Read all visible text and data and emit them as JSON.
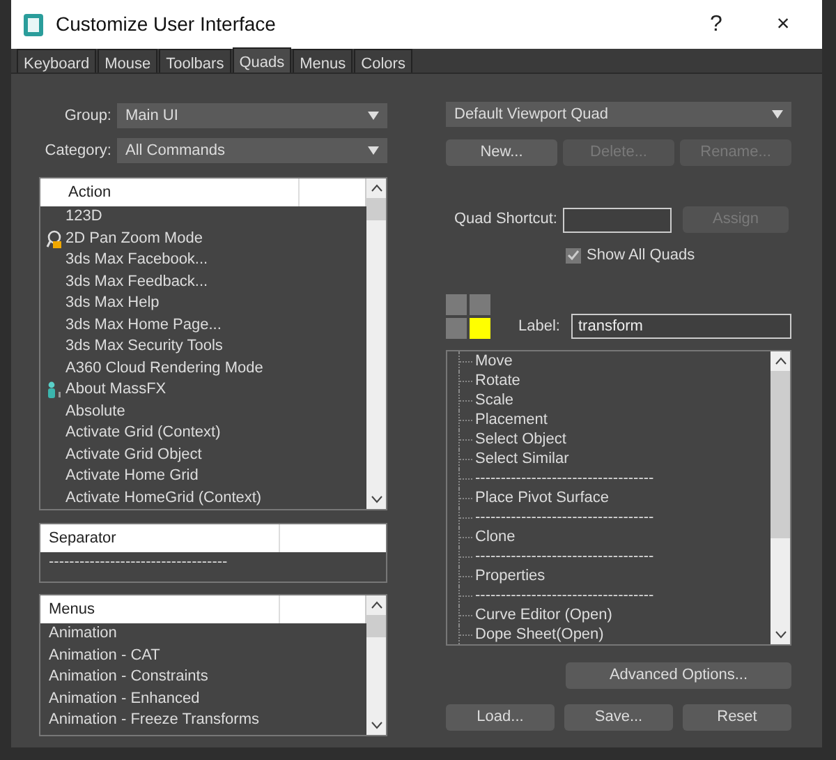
{
  "window": {
    "title": "Customize User Interface",
    "help": "?",
    "close": "×"
  },
  "tabs": [
    {
      "label": "Keyboard",
      "selected": false
    },
    {
      "label": "Mouse",
      "selected": false
    },
    {
      "label": "Toolbars",
      "selected": false
    },
    {
      "label": "Quads",
      "selected": true
    },
    {
      "label": "Menus",
      "selected": false
    },
    {
      "label": "Colors",
      "selected": false
    }
  ],
  "group": {
    "label": "Group:",
    "value": "Main UI"
  },
  "category": {
    "label": "Category:",
    "value": "All Commands"
  },
  "action_list": {
    "header": "Action",
    "items": [
      {
        "text": "123D"
      },
      {
        "text": "2D Pan Zoom Mode",
        "kind": "magnifier"
      },
      {
        "text": "3ds Max Facebook..."
      },
      {
        "text": "3ds Max Feedback..."
      },
      {
        "text": "3ds Max Help"
      },
      {
        "text": "3ds Max Home Page..."
      },
      {
        "text": "3ds Max Security Tools"
      },
      {
        "text": "A360 Cloud Rendering Mode"
      },
      {
        "text": "About MassFX",
        "kind": "figure"
      },
      {
        "text": "Absolute"
      },
      {
        "text": "Activate Grid (Context)"
      },
      {
        "text": "Activate Grid Object"
      },
      {
        "text": "Activate Home Grid"
      },
      {
        "text": "Activate HomeGrid (Context)"
      }
    ]
  },
  "separator_list": {
    "header": "Separator",
    "items": [
      "-----------------------------------"
    ]
  },
  "menus_list": {
    "header": "Menus",
    "items": [
      "Animation",
      "Animation - CAT",
      "Animation - Constraints",
      "Animation - Enhanced",
      "Animation - Freeze Transforms"
    ]
  },
  "quad_menu": {
    "value": "Default Viewport Quad"
  },
  "quad_buttons": [
    {
      "label": "New...",
      "disabled": false
    },
    {
      "label": "Delete...",
      "disabled": true
    },
    {
      "label": "Rename...",
      "disabled": true
    }
  ],
  "quad_shortcut": {
    "label": "Quad Shortcut:"
  },
  "assign_button": {
    "label": "Assign",
    "disabled": true
  },
  "show_all_quads": {
    "label": "Show All Quads",
    "checked": true
  },
  "quadrants": [
    {
      "selected": false
    },
    {
      "selected": false
    },
    {
      "selected": false
    },
    {
      "selected": true
    }
  ],
  "quad_label": {
    "label": "Label:",
    "value": "transform"
  },
  "quad_items": [
    "Move",
    "Rotate",
    "Scale",
    "Placement",
    "Select Object",
    "Select Similar",
    "-----------------------------------",
    "Place Pivot Surface",
    "-----------------------------------",
    "Clone",
    "-----------------------------------",
    "Properties",
    "-----------------------------------",
    "Curve Editor (Open)",
    "Dope Sheet(Open)"
  ],
  "advanced_button": {
    "label": "Advanced Options..."
  },
  "footer_buttons": [
    {
      "label": "Load..."
    },
    {
      "label": "Save..."
    },
    {
      "label": "Reset"
    }
  ]
}
